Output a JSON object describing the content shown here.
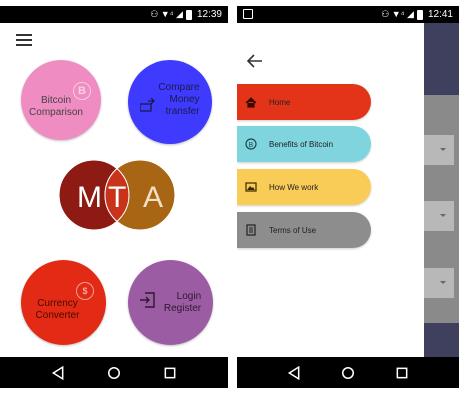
{
  "left_screen": {
    "status_time": "12:39",
    "buttons": {
      "bitcoin": {
        "label": "Bitcoin\nComparison",
        "color": "#ef8cc1"
      },
      "compare": {
        "label": "Compare\nMoney\ntransfer",
        "color": "#3e3bff"
      },
      "currency": {
        "label": "Currency\nConverter",
        "color": "#e22a14"
      },
      "login": {
        "label": "Login\nRegister",
        "color": "#9c5ca3"
      }
    },
    "logo": {
      "letters": [
        "M",
        "T",
        "A"
      ],
      "colors": [
        "#8e1a14",
        "#c8331b",
        "#a86614"
      ]
    }
  },
  "right_screen": {
    "status_time": "12:41",
    "menu": [
      {
        "label": "Home",
        "icon": "home-icon",
        "color": "#e33419"
      },
      {
        "label": "Benefits of Bitcoin",
        "icon": "bitcoin-icon",
        "color": "#7fd4de"
      },
      {
        "label": "How We work",
        "icon": "image-icon",
        "color": "#f9cb57"
      },
      {
        "label": "Terms of Use",
        "icon": "document-icon",
        "color": "#8d8d8d"
      }
    ]
  }
}
